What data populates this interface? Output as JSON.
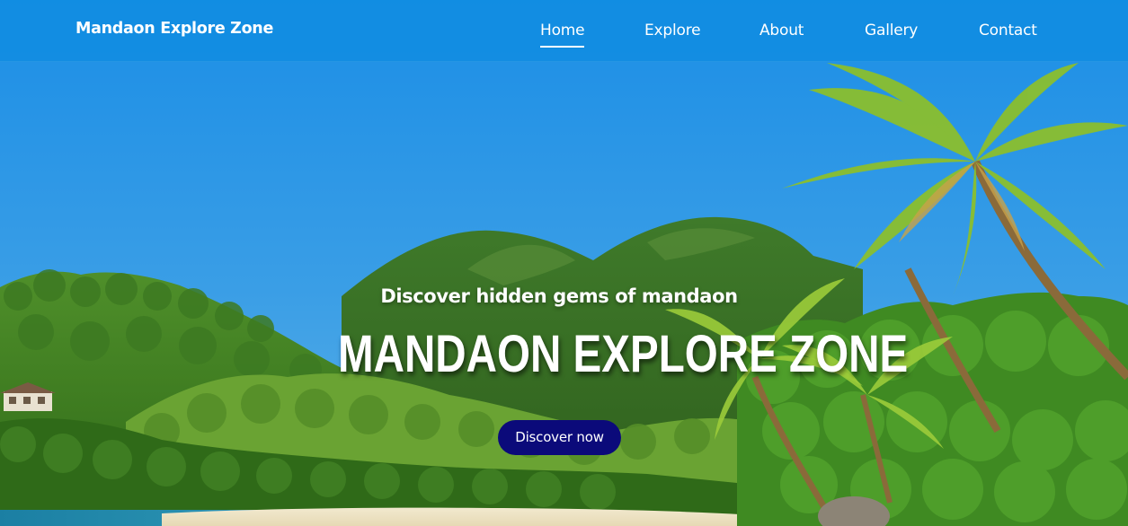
{
  "navbar": {
    "brand": "Mandaon Explore Zone",
    "links": [
      {
        "label": "Home",
        "active": true
      },
      {
        "label": "Explore",
        "active": false
      },
      {
        "label": "About",
        "active": false
      },
      {
        "label": "Gallery",
        "active": false
      },
      {
        "label": "Contact",
        "active": false
      }
    ]
  },
  "hero": {
    "tagline": "Discover hidden gems of mandaon",
    "title": "MANDAON EXPLORE ZONE",
    "cta_label": "Discover now"
  },
  "colors": {
    "sky": "#2f95e0",
    "navbar": "#108ce0",
    "cta": "#0b0a7a",
    "text": "#ffffff"
  }
}
